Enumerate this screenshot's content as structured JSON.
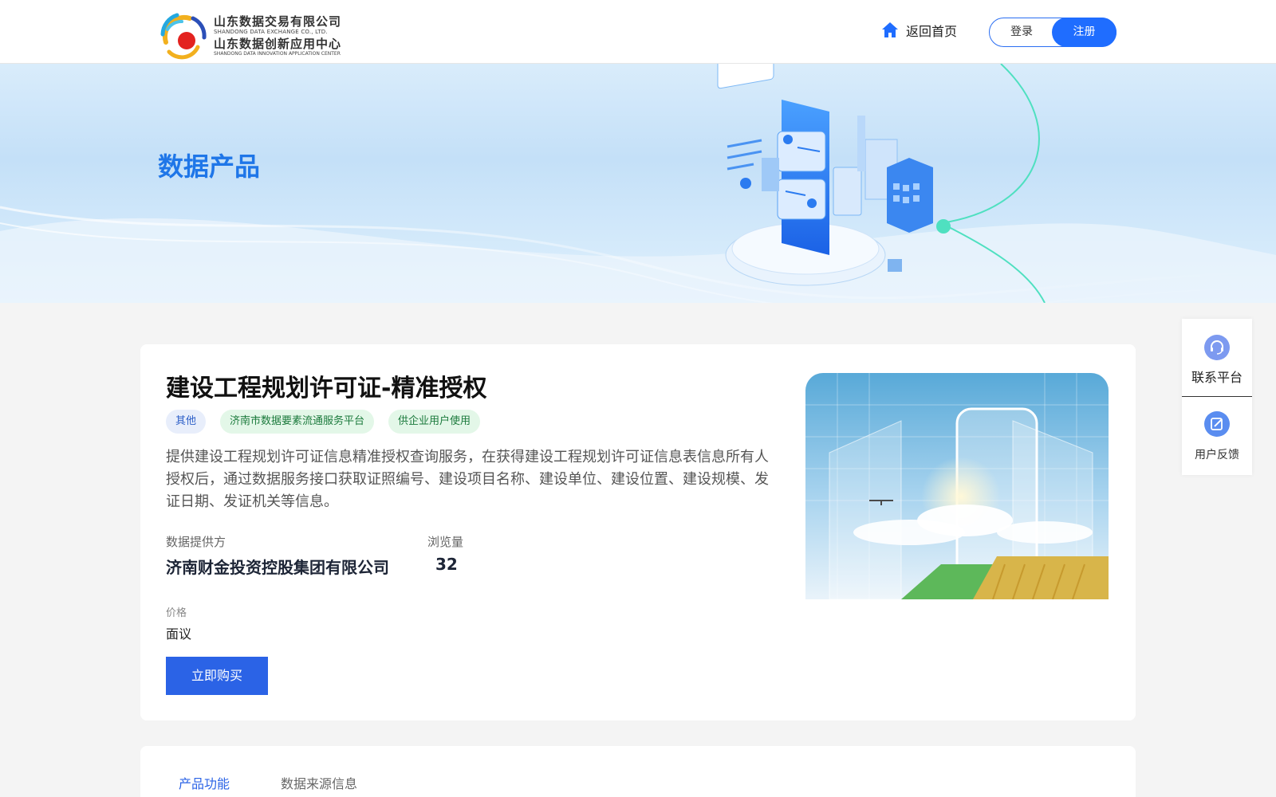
{
  "header": {
    "logo": {
      "cn_name_1": "山东数据交易有限公司",
      "en_name_1": "SHANDONG DATA EXCHANGE CO., LTD.",
      "cn_name_2": "山东数据创新应用中心",
      "en_name_2": "SHANDONG DATA INNOVATION APPLICATION CENTER"
    },
    "home_label": "返回首页",
    "login_label": "登录",
    "register_label": "注册"
  },
  "banner": {
    "title": "数据产品"
  },
  "product": {
    "title": "建设工程规划许可证-精准授权",
    "tags": [
      "其他",
      "济南市数据要素流通服务平台",
      "供企业用户使用"
    ],
    "description": "提供建设工程规划许可证信息精准授权查询服务，在获得建设工程规划许可证信息表信息所有人授权后，通过数据服务接口获取证照编号、建设项目名称、建设单位、建设位置、建设规模、发证日期、发证机关等信息。",
    "provider_label": "数据提供方",
    "provider_value": "济南财金投资控股集团有限公司",
    "views_label": "浏览量",
    "views_value": "32",
    "price_label": "价格",
    "price_value": "面议",
    "buy_label": "立即购买"
  },
  "side_widget": {
    "contact_label": "联系平台",
    "feedback_label": "用户反馈"
  },
  "tabs": [
    {
      "label": "产品功能",
      "active": true
    },
    {
      "label": "数据来源信息",
      "active": false
    }
  ],
  "colors": {
    "primary": "#1f6dff",
    "banner_title": "#1f76e8",
    "buy_button": "#2b63e6",
    "tag_blue_bg": "#e8eefb",
    "tag_green_bg": "#e3f7e8"
  }
}
